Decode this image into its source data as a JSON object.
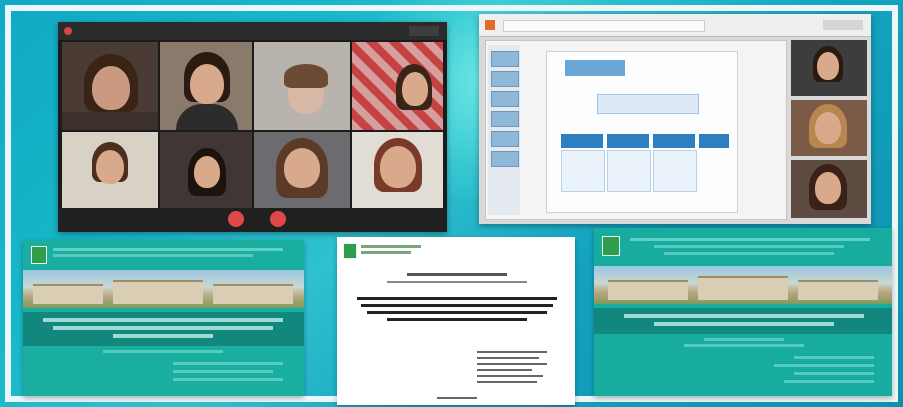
{
  "description_text": [],
  "colors": {
    "background_teal": "#17b7c8",
    "slide_teal": "#1aaea1",
    "slide_dark_green": "#11877e",
    "call_red": "#e04848"
  },
  "icons": [
    "hang-up-icon",
    "mute-icon",
    "university-emblem-icon"
  ]
}
